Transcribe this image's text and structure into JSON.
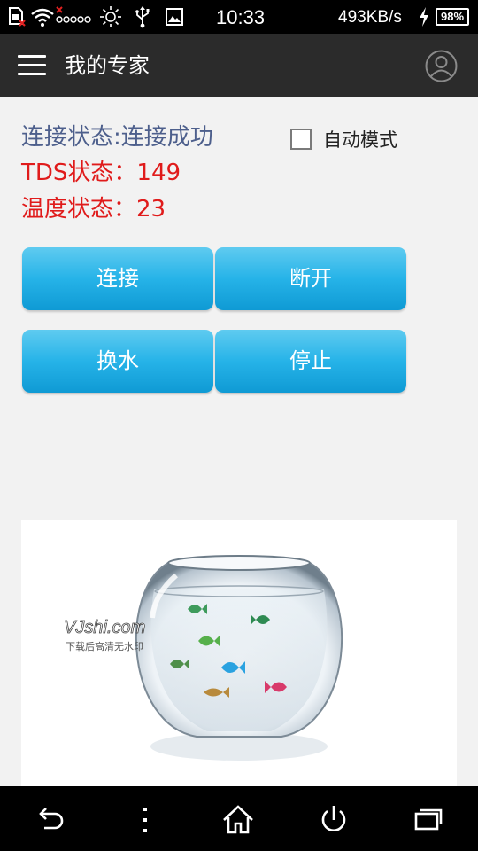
{
  "status_bar": {
    "time": "10:33",
    "network_speed": "493KB/s",
    "battery": "98%",
    "icons": [
      "sd-card-error-icon",
      "wifi-icon",
      "signal-none-icon",
      "brightness-icon",
      "usb-icon",
      "image-icon",
      "charging-icon",
      "battery-icon"
    ]
  },
  "app_bar": {
    "title": "我的专家",
    "menu_icon": "hamburger-menu-icon",
    "avatar_icon": "user-profile-icon"
  },
  "status": {
    "connection": "连接状态:连接成功",
    "tds": "TDS状态：149",
    "temperature": "温度状态：23"
  },
  "auto_mode": {
    "label": "自动模式",
    "checked": false
  },
  "buttons": {
    "connect": "连接",
    "disconnect": "断开",
    "change_water": "换水",
    "stop": "停止"
  },
  "image": {
    "watermark_brand": "VJshi.com",
    "watermark_note": "下载后高清无水印"
  },
  "nav_bar": {
    "icons": [
      "back-icon",
      "menu-dots-icon",
      "home-icon",
      "power-icon",
      "recent-apps-icon"
    ]
  },
  "colors": {
    "connection_text": "#4d5f8c",
    "status_red": "#e01b1b",
    "button_blue": "#26b3e8",
    "app_bar": "#2b2b2b"
  }
}
